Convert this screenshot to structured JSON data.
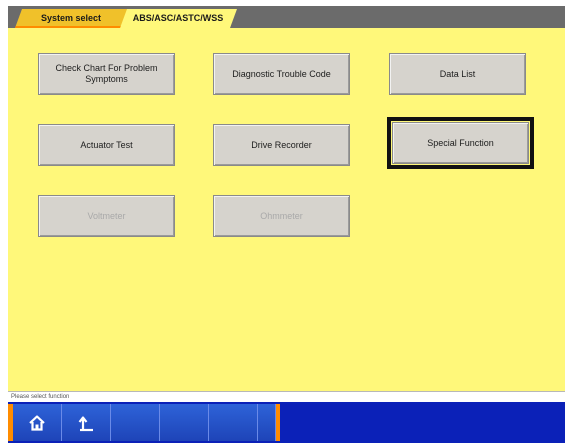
{
  "tabs": {
    "system_select": "System select",
    "current": "ABS/ASC/ASTC/WSS"
  },
  "functions": {
    "check_chart": "Check Chart For Problem Symptoms",
    "dtc": "Diagnostic Trouble Code",
    "data_list": "Data List",
    "actuator_test": "Actuator Test",
    "drive_recorder": "Drive Recorder",
    "special_function": "Special Function",
    "voltmeter": "Voltmeter",
    "ohmmeter": "Ohmmeter"
  },
  "status": {
    "message": "Please select function"
  },
  "toolbar": {
    "icons": [
      "home-icon",
      "return-icon"
    ]
  },
  "colors": {
    "content_bg": "#fff87a",
    "active_tab": "#f0c12a",
    "toolbar_bg": "#0b21b8",
    "accent": "#ff8c00",
    "button_bg": "#d6d3cd"
  }
}
